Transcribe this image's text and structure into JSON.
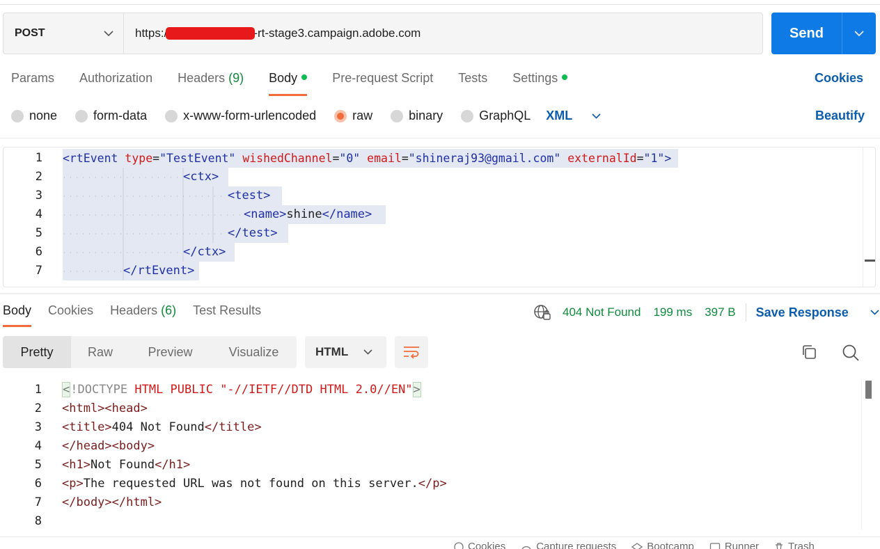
{
  "request": {
    "method": "POST",
    "url_prefix": "https:/",
    "url_suffix": "-rt-stage3.campaign.adobe.com",
    "send_label": "Send"
  },
  "req_tabs": [
    {
      "label": "Params"
    },
    {
      "label": "Authorization"
    },
    {
      "label": "Headers",
      "count": "(9)"
    },
    {
      "label": "Body"
    },
    {
      "label": "Pre-request Script"
    },
    {
      "label": "Tests"
    },
    {
      "label": "Settings"
    }
  ],
  "cookies_label": "Cookies",
  "body_types": [
    "none",
    "form-data",
    "x-www-form-urlencoded",
    "raw",
    "binary",
    "GraphQL"
  ],
  "body_language": "XML",
  "beautify_label": "Beautify",
  "request_body": {
    "line_numbers": [
      "1",
      "2",
      "3",
      "4",
      "5",
      "6",
      "7"
    ],
    "l1": {
      "open": "<rtEvent ",
      "a1": "type",
      "v1": "\"TestEvent\"",
      "a2": "wishedChannel",
      "v2": "\"0\"",
      "a3": "email",
      "v3": "\"shineraj93@gmail.com\"",
      "a4": "externalId",
      "v4": "\"1\"",
      "close": ">"
    },
    "l2": "<ctx>",
    "l3": "<test>",
    "l4_open": "<name>",
    "l4_text": "shine",
    "l4_close": "</name>",
    "l5": "</test>",
    "l6": "</ctx>",
    "l7": "</rtEvent>"
  },
  "resp_tabs": [
    {
      "label": "Body"
    },
    {
      "label": "Cookies"
    },
    {
      "label": "Headers",
      "count": "(6)"
    },
    {
      "label": "Test Results"
    }
  ],
  "status": {
    "code": "404 Not Found",
    "time": "199 ms",
    "size": "397 B"
  },
  "save_response_label": "Save Response",
  "view_modes": [
    "Pretty",
    "Raw",
    "Preview",
    "Visualize"
  ],
  "response_format": "HTML",
  "response_body": {
    "line_numbers": [
      "1",
      "2",
      "3",
      "4",
      "5",
      "6",
      "7",
      "8"
    ],
    "l1_lt": "<",
    "l1_doctype": "!DOCTYPE",
    "l1_rest": " HTML PUBLIC \"-//IETF//DTD HTML 2.0//EN\"",
    "l1_gt": ">",
    "l2": "<html><head>",
    "l3_open": "<title>",
    "l3_text": "404 Not Found",
    "l3_close": "</title>",
    "l4": "</head><body>",
    "l5_open": "<h1>",
    "l5_text": "Not Found",
    "l5_close": "</h1>",
    "l6_open": "<p>",
    "l6_text": "The requested URL was not found on this server.",
    "l6_close": "</p>",
    "l7": "</body></html>"
  },
  "footer": [
    "Cookies",
    "Capture requests",
    "Bootcamp",
    "Runner",
    "Trash"
  ],
  "colors": {
    "accent": "#f26b3a",
    "send": "#0d7ae6",
    "link": "#0b5cad",
    "status_ok": "#0f8a3c"
  },
  "icons": [
    "chevron-down-icon",
    "globe-icon",
    "wrap-lines-icon",
    "copy-icon",
    "search-icon",
    "cookie-icon",
    "capture-icon",
    "bootcamp-icon",
    "runner-icon",
    "trash-icon"
  ]
}
